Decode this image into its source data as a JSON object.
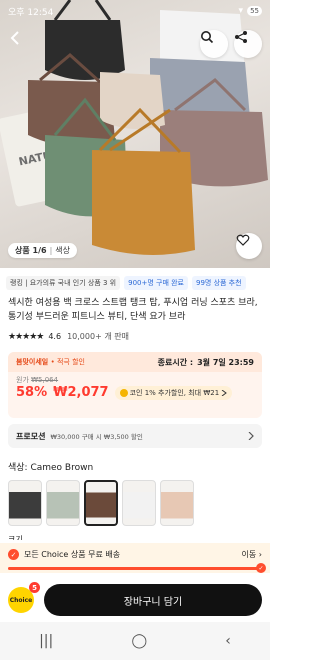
{
  "status_bar": {
    "time": "오후 12:54",
    "battery": "55"
  },
  "gallery": {
    "counter_label": "상품 1/6",
    "variant_label": "색상"
  },
  "badges": [
    {
      "text": "랭킹 | 요가의류 국내 인기 상품 3 위"
    },
    {
      "text": "900+명 구매 완료"
    },
    {
      "text": "99명 상품 추천"
    }
  ],
  "product": {
    "title": "섹시한 여성용 백 크로스 스트랩 탱크 탑, 푸시업 러닝 스포츠 브라, 통기성 부드러운 피트니스 뷰티, 단색 요가 브라",
    "rating": "4.6",
    "sold": "10,000+ 개 판매"
  },
  "sale": {
    "tag": "봄맞이세일",
    "tag_sub": "• 적극 할인",
    "end_label": "종료시간 :",
    "end_time": "3월 7일 23:59",
    "original_label": "원가",
    "original_price": "₩5,064",
    "discount": "58%",
    "price": "₩2,077",
    "coin_text": "코인 1% 추가할인, 최대 ₩21"
  },
  "promotion": {
    "label": "프로모션",
    "text": "₩30,000 구매 시 ₩3,500 할인"
  },
  "color": {
    "label": "색상: Cameo Brown",
    "swatches": [
      "#3c3c3c",
      "#b7c2b6",
      "#6b4a3a",
      "#f2f2f2",
      "#e7c8b4"
    ],
    "selected_index": 2
  },
  "size_label": "크기",
  "choice": {
    "text": "모든 Choice 상품 무료 배송",
    "action": "이동",
    "progress": 1.0,
    "accent": "#ff4d2d"
  },
  "action": {
    "logo_text": "Choice",
    "cart_count": "5",
    "cart_button": "장바구니 담기"
  }
}
